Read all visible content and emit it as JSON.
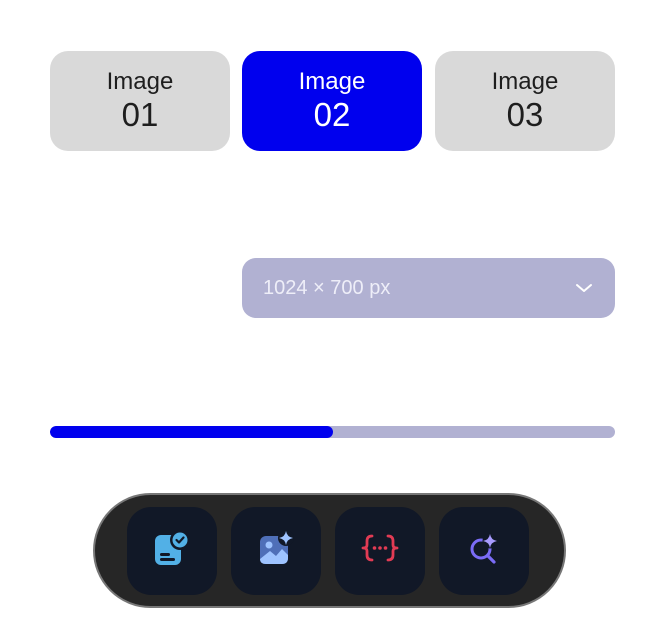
{
  "tabs": [
    {
      "label": "Image",
      "number": "01",
      "selected": false
    },
    {
      "label": "Image",
      "number": "02",
      "selected": true
    },
    {
      "label": "Image",
      "number": "03",
      "selected": false
    }
  ],
  "size_select": {
    "value": "1024 × 700 px",
    "icon": "chevron-down-icon"
  },
  "progress": {
    "value_percent": 50
  },
  "dock": {
    "items": [
      {
        "icon": "verified-document-icon"
      },
      {
        "icon": "ai-image-icon"
      },
      {
        "icon": "code-braces-icon"
      },
      {
        "icon": "ai-search-icon"
      }
    ]
  },
  "colors": {
    "accent": "#0000ee",
    "tab_inactive": "#d9d9d9",
    "muted": "#b1b1d2",
    "dock_bg": "#262626",
    "dock_button": "#111827"
  }
}
